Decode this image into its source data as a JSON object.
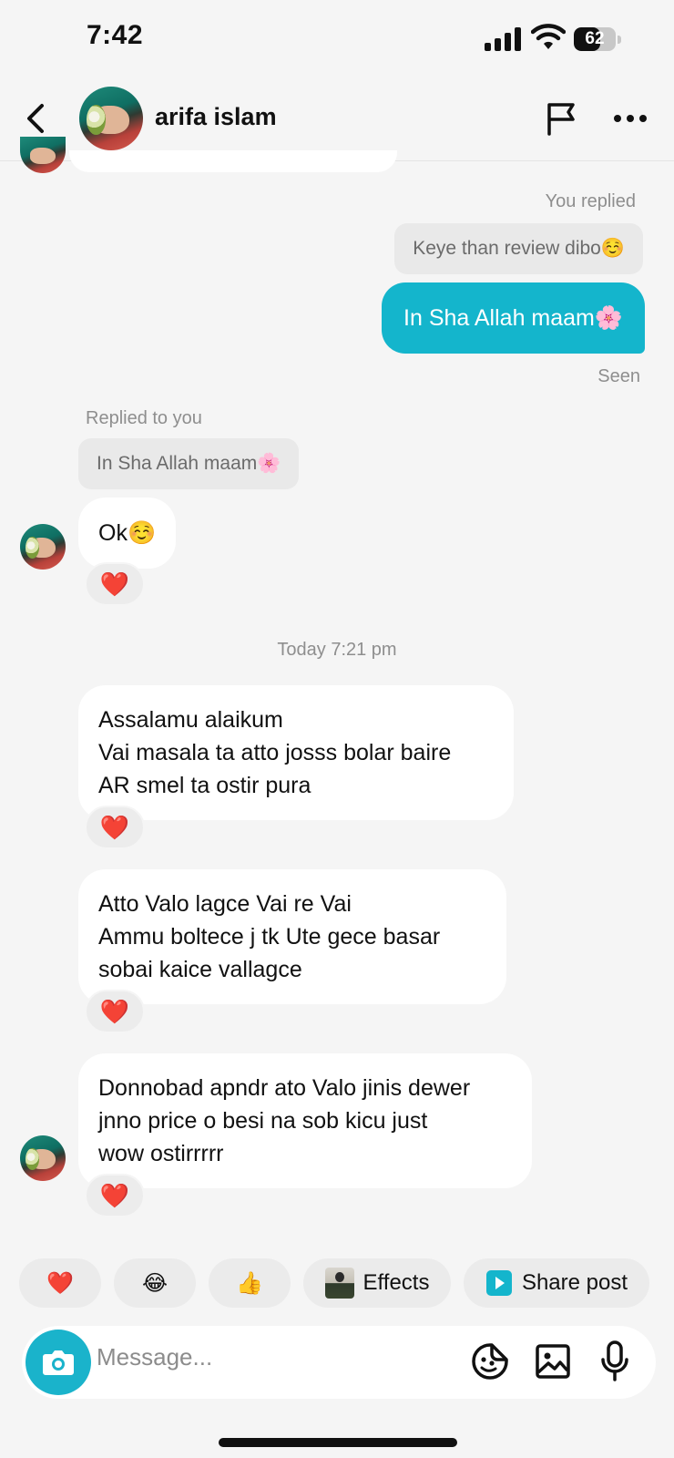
{
  "status_bar": {
    "time": "7:42",
    "battery": "62",
    "battery_level": 0.62
  },
  "header": {
    "name": "arifa islam",
    "back_icon": "chevron-left-icon",
    "report_icon": "flag-icon",
    "more_icon": "more-horizontal-icon"
  },
  "messages": {
    "you_replied_label": "You replied",
    "quoted_out": "Keye than review dibo☺️",
    "outgoing_1": "In Sha Allah maam🌸",
    "seen": "Seen",
    "replied_to_you_label": "Replied to you",
    "quoted_in": "In Sha Allah maam🌸",
    "incoming_ok": "Ok☺️",
    "reaction": "❤️",
    "timestamp": "Today 7:21 pm",
    "incoming_1": "Assalamu alaikum\nVai masala ta atto josss bolar baire\nAR smel ta ostir pura",
    "incoming_2": "Atto Valo lagce Vai re Vai\nAmmu boltece j tk Ute gece basar\nsobai kaice vallagce",
    "incoming_3": "Donnobad apndr ato Valo jinis dewer\njnno price o besi na sob kicu just\nwow ostirrrrr"
  },
  "quick_actions": {
    "heart": "❤️",
    "laugh": "😂",
    "thumbs_up": "👍",
    "effects_label": "Effects",
    "share_label": "Share post"
  },
  "composer": {
    "placeholder": "Message...",
    "camera_icon": "camera-icon",
    "sticker_icon": "sticker-icon",
    "gallery_icon": "image-icon",
    "mic_icon": "microphone-icon"
  },
  "colors": {
    "accent": "#14b5cc",
    "background": "#f5f5f5",
    "bubble_in": "#ffffff"
  }
}
